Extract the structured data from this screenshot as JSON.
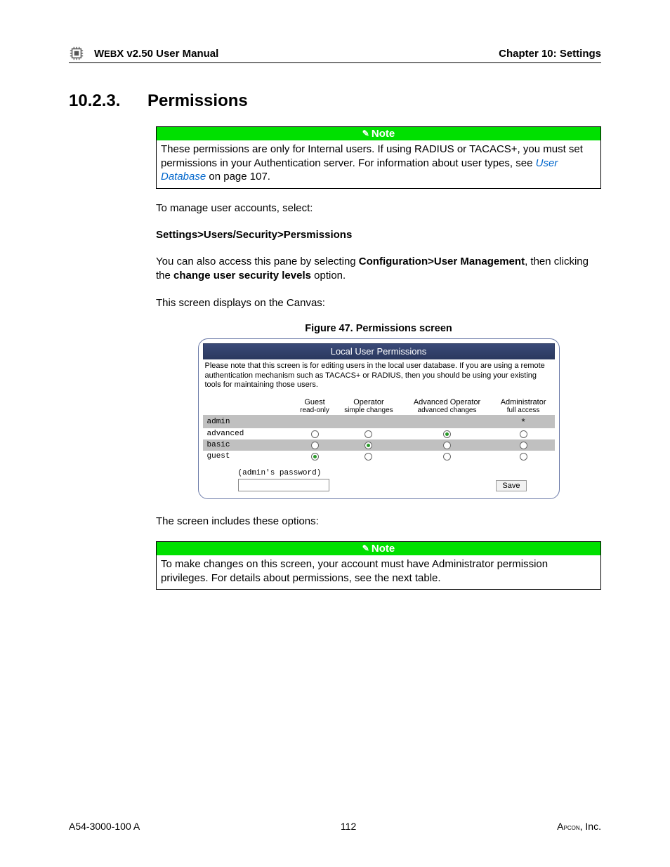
{
  "header": {
    "product": "WebX v2.50 User Manual",
    "chapter": "Chapter 10: Settings"
  },
  "section": {
    "number": "10.2.3.",
    "title": "Permissions"
  },
  "note1": {
    "label": "Note",
    "body_pre": "These permissions are only for Internal users. If using RADIUS or TACACS+, you must set permissions in your Authentication server. For information about user types, see ",
    "link": "User Database",
    "body_post": " on page 107."
  },
  "para1": "To manage user accounts, select:",
  "path": "Settings>Users/Security>Persmissions",
  "para2_pre": "You can also access this pane by selecting ",
  "para2_b1": "Configuration>User Management",
  "para2_mid": ", then clicking the ",
  "para2_b2": "change user security levels",
  "para2_post": " option.",
  "para3": "This screen displays on the Canvas:",
  "figure_caption": "Figure 47. Permissions screen",
  "screenshot": {
    "title": "Local User Permissions",
    "note": "Please note that this screen is for editing users in the local user database. If you are using a remote authentication mechanism such as TACACS+ or RADIUS, then you should be using your existing tools for maintaining those users.",
    "columns": [
      {
        "top": "Guest",
        "sub": "read-only"
      },
      {
        "top": "Operator",
        "sub": "simple changes"
      },
      {
        "top": "Advanced Operator",
        "sub": "advanced changes"
      },
      {
        "top": "Administrator",
        "sub": "full access"
      }
    ],
    "rows": [
      {
        "user": "admin",
        "cells": [
          "",
          "",
          "",
          "star"
        ]
      },
      {
        "user": "advanced",
        "cells": [
          "radio",
          "radio",
          "radio-sel",
          "radio"
        ]
      },
      {
        "user": "basic",
        "cells": [
          "radio",
          "radio-sel",
          "radio",
          "radio"
        ]
      },
      {
        "user": "guest",
        "cells": [
          "radio-sel",
          "radio",
          "radio",
          "radio"
        ]
      }
    ],
    "password_label": "(admin's password)",
    "save_label": "Save"
  },
  "para4": "The screen includes these options:",
  "note2": {
    "label": "Note",
    "body": "To make changes on this screen, your account must have Administrator permission privileges. For details about permissions, see the next table."
  },
  "footer": {
    "left": "A54-3000-100 A",
    "center": "112",
    "right_pre": "A",
    "right_sc": "pcon",
    "right_post": ", Inc."
  }
}
